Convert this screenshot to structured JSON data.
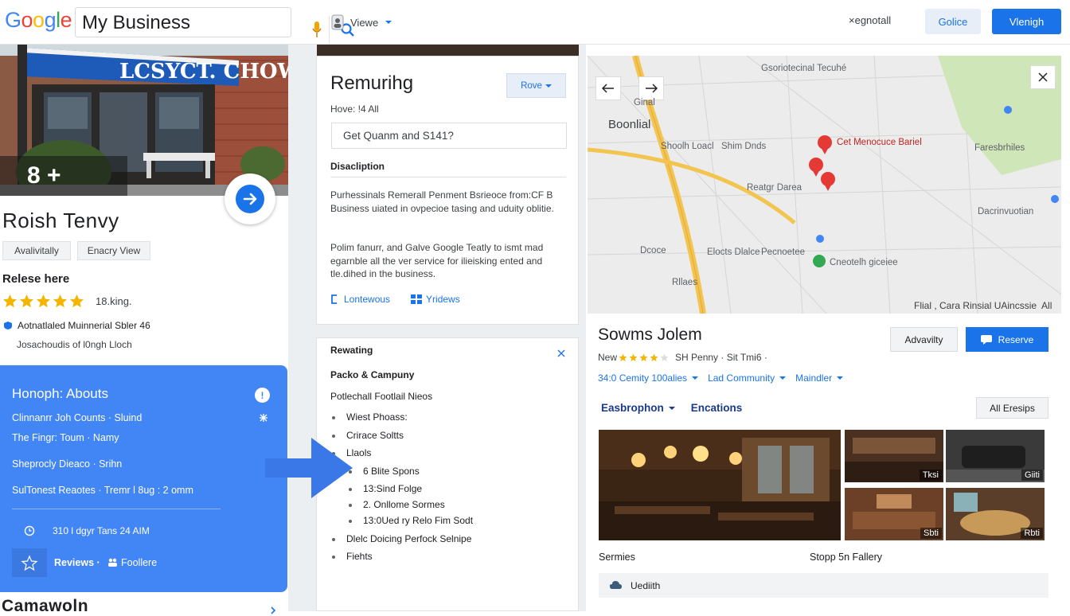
{
  "header": {
    "logo_letters": [
      {
        "ch": "G",
        "color": "#4285f4"
      },
      {
        "ch": "o",
        "color": "#ea4335"
      },
      {
        "ch": "o",
        "color": "#fbbc05"
      },
      {
        "ch": "g",
        "color": "#4285f4"
      },
      {
        "ch": "l",
        "color": "#34a853"
      },
      {
        "ch": "e",
        "color": "#ea4335"
      }
    ],
    "search_value": "My Business",
    "viewer_label": "Viewe",
    "signout_label": "×egnotall",
    "secondary_button": "Golice",
    "primary_button": "Vlenigh"
  },
  "left": {
    "photo_sign": "LCSYCT. CHOWN",
    "photo_count": "8 +",
    "business_name": "Roish Tenvy",
    "chips": [
      "Avalivitally",
      "Enacry View"
    ],
    "section_title": "Relese here",
    "rating_text": "18.king.",
    "address": "Aotnatlaled Muinnerial Sbler 46",
    "address_sub": "Josachoudis of l0ngh Lloch",
    "info_card": {
      "title": "Honoph: Abouts",
      "badge": "!",
      "lines": [
        "Clinnanrr  Joh Counts  ·  Sluind",
        "The Fingr: Toum · Namy",
        "Sheprocly Dieaco · Srihn",
        "SulTonest Reaotes · Tremr l 8ug : 2 omm"
      ],
      "hours": "310 l dgyr  Tans  24 AIM",
      "reviews_label": "Reviews ·",
      "foolere_label": "Foollere"
    },
    "bottom_heading": "Camawoln"
  },
  "middle": {
    "card1": {
      "title": "Remurihg",
      "subtitle": "Hove: !4 All",
      "rove_button": "Rove",
      "quote_field": "Get Quanm and S141?",
      "desc_heading": "Disacliption",
      "desc_p1": "Purhessinals Remerall Penment Bsrieoce from:CF B Business uiated in ovpecioe tasing and uduity oblitie.",
      "desc_p2": "Polim fanurr, and Galve Google Teatly to ismt mad egarnble all the ver service for ilieisking ented and tle.dihed in the business.",
      "link1": "Lontewous",
      "link2": "Yridews"
    },
    "card2": {
      "heading": "Rewating",
      "line1": "Packo & Campuny",
      "line2": "Potlechall Footlail Nieos",
      "items": [
        {
          "text": "Wiest Phoass:",
          "level": 1
        },
        {
          "text": "Crirace Soltts",
          "level": 1
        },
        {
          "text": "Llaols",
          "level": 1
        },
        {
          "text": "6 Blite Spons",
          "level": 2
        },
        {
          "text": "13:Sind Folge",
          "level": 2
        },
        {
          "text": "2. Onllome Sormes",
          "level": 2
        },
        {
          "text": "13:0Ued ry Relo Fim Sodt",
          "level": 2
        },
        {
          "text": "Dlelc Doicing Perfock Selnipe",
          "level": 1
        },
        {
          "text": "Fiehts",
          "level": 1
        }
      ]
    }
  },
  "right": {
    "map": {
      "labels": [
        "Gsoriotecinal Tecuhé",
        "Ginal",
        "Boonlial",
        "Shoolh Loacl",
        "Shim Dnds",
        "Cet Menocuce Bariel",
        "Faresbrhiles",
        "Reatgr Darea",
        "Dacrinvuotian",
        "Dcoce",
        "Elocts Dlalce",
        "Pecnoetee",
        "Cneotelh giceiee",
        "Rllaes"
      ],
      "footer": "Flial ,  Cara Rinsial UAincssie  All"
    },
    "place_title": "Sowms Jolem",
    "availability_button": "Advavilty",
    "reserve_button": "Reserve",
    "meta_prefix": "New",
    "meta_suffix": "SH Penny · Sit Tmi6 ·",
    "filters": [
      "34:0 Cemity 100alies",
      "Lad Community",
      "Maindler"
    ],
    "tabs": [
      "Easbrophon",
      "Encations"
    ],
    "all_button": "All Eresips",
    "thumb_tags": [
      "Tksi",
      "Giiti",
      "Sbti",
      "Rbti"
    ],
    "gallery_left_label": "Sermies",
    "gallery_right_label": "Stopp 5n Fallery",
    "update_label": "Uediith"
  }
}
